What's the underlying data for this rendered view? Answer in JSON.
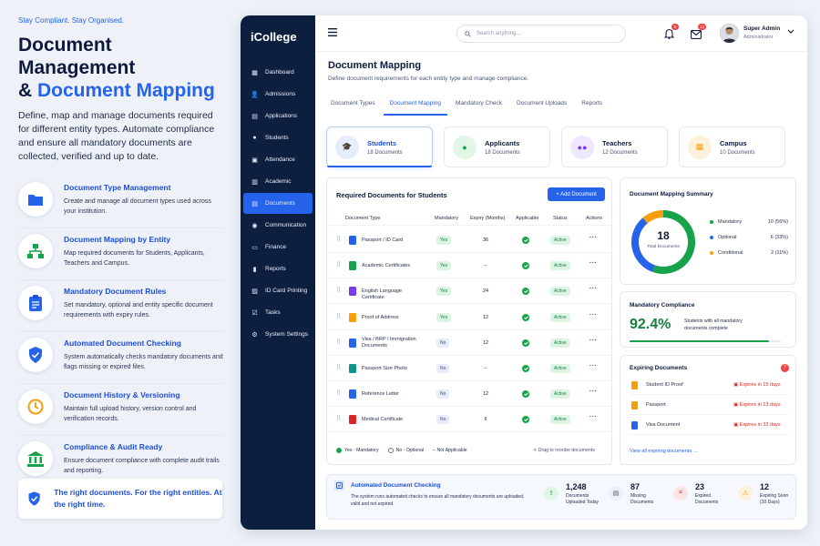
{
  "left": {
    "tagline": "Stay Compliant. Stay Organised.",
    "title_line1": "Document Management",
    "title_amp": "& ",
    "title_highlight": "Document Mapping",
    "description": "Define, map and manage documents required for different entity types. Automate compliance and ensure all mandatory documents are collected, verified and up to date.",
    "features": [
      {
        "icon": "folder-icon",
        "title": "Document Type Management",
        "desc": "Create and manage all document types used across your institution."
      },
      {
        "icon": "hierarchy-icon",
        "title": "Document Mapping by Entity",
        "desc": "Map required documents for Students, Applicants, Teachers and Campus."
      },
      {
        "icon": "clipboard-icon",
        "title": "Mandatory Document Rules",
        "desc": "Set mandatory, optional and entity specific document requirements with expiry rules."
      },
      {
        "icon": "shield-check-icon",
        "title": "Automated Document Checking",
        "desc": "System automatically checks mandatory documents and flags missing or expired files."
      },
      {
        "icon": "clock-icon",
        "title": "Document History & Versioning",
        "desc": "Maintain full upload history, version control and verification records."
      },
      {
        "icon": "bank-icon",
        "title": "Compliance & Audit Ready",
        "desc": "Ensure document compliance with complete audit trails and reporting."
      }
    ],
    "promo": "The right documents. For the right entities. At the right time."
  },
  "app": {
    "brand": "iCollege",
    "nav": [
      {
        "label": "Dashboard",
        "icon": "grid-icon",
        "active": false
      },
      {
        "label": "Admissions",
        "icon": "user-plus-icon",
        "active": false
      },
      {
        "label": "Applications",
        "icon": "file-icon",
        "active": false
      },
      {
        "label": "Students",
        "icon": "user-icon",
        "active": false
      },
      {
        "label": "Attendance",
        "icon": "calendar-check-icon",
        "active": false
      },
      {
        "label": "Academic",
        "icon": "book-icon",
        "active": false
      },
      {
        "label": "Documents",
        "icon": "document-icon",
        "active": true
      },
      {
        "label": "Communication",
        "icon": "chat-icon",
        "active": false
      },
      {
        "label": "Finance",
        "icon": "wallet-icon",
        "active": false
      },
      {
        "label": "Reports",
        "icon": "chart-icon",
        "active": false
      },
      {
        "label": "ID Card Printing",
        "icon": "printer-icon",
        "active": false
      },
      {
        "label": "Tasks",
        "icon": "checkbox-icon",
        "active": false
      },
      {
        "label": "System Settings",
        "icon": "gear-icon",
        "active": false
      }
    ],
    "search_placeholder": "Search anything...",
    "notif_count": "5",
    "mail_count": "12",
    "user_name": "Super Admin",
    "user_role": "Administrator",
    "page_title": "Document Mapping",
    "page_subtitle": "Define document requirements for each entity type and manage compliance.",
    "tabs": [
      "Document Types",
      "Document Mapping",
      "Mandatory Check",
      "Document Uploads",
      "Reports"
    ],
    "active_tab": 1,
    "entities": [
      {
        "name": "Students",
        "count": "18 Documents",
        "color": "#2563eb",
        "bg": "#e5edfd",
        "icon": "graduation-cap-icon"
      },
      {
        "name": "Applicants",
        "count": "18 Documents",
        "color": "#16a34a",
        "bg": "#e2f6e8",
        "icon": "person-icon"
      },
      {
        "name": "Teachers",
        "count": "12 Documents",
        "color": "#7c3aed",
        "bg": "#efe7fd",
        "icon": "people-icon"
      },
      {
        "name": "Campus",
        "count": "10 Documents",
        "color": "#f59e0b",
        "bg": "#fdf1dc",
        "icon": "building-icon"
      }
    ],
    "table": {
      "title": "Required Documents for Students",
      "add_label": "+ Add Document",
      "headers": [
        "Document Type",
        "Mandatory",
        "Expiry (Months)",
        "Applicable",
        "Status",
        "Actions"
      ],
      "rows": [
        {
          "name": "Passport / ID Card",
          "mandatory": "Yes",
          "expiry": "36",
          "status": "Active",
          "color": "#2563eb"
        },
        {
          "name": "Academic Certificates",
          "mandatory": "Yes",
          "expiry": "–",
          "status": "Active",
          "color": "#16a34a"
        },
        {
          "name": "English Language Certificate",
          "mandatory": "Yes",
          "expiry": "24",
          "status": "Active",
          "color": "#7c3aed"
        },
        {
          "name": "Proof of Address",
          "mandatory": "Yes",
          "expiry": "12",
          "status": "Active",
          "color": "#f59e0b"
        },
        {
          "name": "Visa / BRP / Immigration Documents",
          "mandatory": "No",
          "expiry": "12",
          "status": "Active",
          "color": "#2563eb"
        },
        {
          "name": "Passport Size Photo",
          "mandatory": "No",
          "expiry": "–",
          "status": "Active",
          "color": "#0d9488"
        },
        {
          "name": "Reference Letter",
          "mandatory": "No",
          "expiry": "12",
          "status": "Active",
          "color": "#2563eb"
        },
        {
          "name": "Medical Certificate",
          "mandatory": "No",
          "expiry": "6",
          "status": "Active",
          "color": "#dc2626"
        }
      ],
      "legend_yes": "Yes - Mandatory",
      "legend_no": "No - Optional",
      "legend_na": "– Not Applicable",
      "drag_hint": "Drag to reorder documents"
    },
    "summary": {
      "title": "Document Mapping Summary",
      "total": "18",
      "total_label": "Total Documents",
      "items": [
        {
          "label": "Mandatory",
          "value": "10 (56%)",
          "color": "#16a34a"
        },
        {
          "label": "Optional",
          "value": "6 (33%)",
          "color": "#2563eb"
        },
        {
          "label": "Conditional",
          "value": "2 (11%)",
          "color": "#f59e0b"
        }
      ]
    },
    "compliance": {
      "title": "Mandatory Compliance",
      "value": "92.4%",
      "desc": "Students with all mandatory documents complete",
      "fraction": 0.924
    },
    "expiring": {
      "title": "Expiring Documents",
      "count": "7",
      "items": [
        {
          "name": "Student ID Proof",
          "when": "Expires in 15 days",
          "color": "#f59e0b"
        },
        {
          "name": "Passport",
          "when": "Expires in 23 days",
          "color": "#f59e0b"
        },
        {
          "name": "Visa Document",
          "when": "Expires in 32 days",
          "color": "#2563eb"
        }
      ],
      "link": "View all expiring documents →"
    },
    "auto": {
      "title": "Automated Document Checking",
      "desc": "The system runs automated checks to ensure all mandatory documents are uploaded, valid and not expired.",
      "stats": [
        {
          "value": "1,248",
          "label1": "Documents",
          "label2": "Uploaded Today",
          "color": "#16a34a",
          "bg": "#e2f6e8"
        },
        {
          "value": "87",
          "label1": "Missing",
          "label2": "Documents",
          "color": "#4b5575",
          "bg": "#eceff5"
        },
        {
          "value": "23",
          "label1": "Expired",
          "label2": "Documents",
          "color": "#dc2626",
          "bg": "#fde4e4"
        },
        {
          "value": "12",
          "label1": "Expiring Soon",
          "label2": "(30 Days)",
          "color": "#f59e0b",
          "bg": "#fdf1dc"
        }
      ]
    }
  }
}
